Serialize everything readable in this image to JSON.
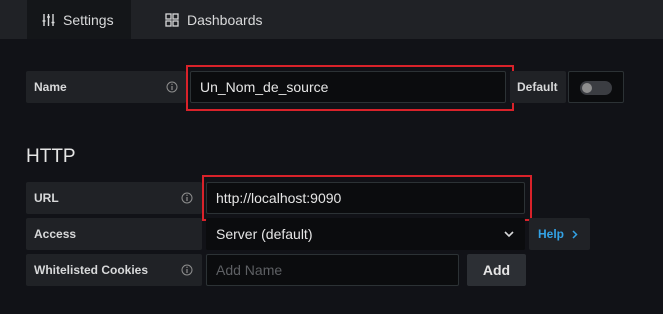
{
  "tabs": {
    "settings": "Settings",
    "dashboards": "Dashboards"
  },
  "name_row": {
    "label": "Name",
    "value": "Un_Nom_de_source",
    "default_label": "Default",
    "default_enabled": false
  },
  "http": {
    "title": "HTTP",
    "url_label": "URL",
    "url_value": "http://localhost:9090",
    "access_label": "Access",
    "access_value": "Server (default)",
    "help_label": "Help",
    "cookies_label": "Whitelisted Cookies",
    "cookies_placeholder": "Add Name",
    "add_label": "Add"
  },
  "colors": {
    "highlight": "#d9222a",
    "help_link": "#33a2e5"
  },
  "icons": [
    "sliders-icon",
    "dashboard-grid-icon",
    "info-icon",
    "chevron-down-icon",
    "chevron-right-icon"
  ]
}
